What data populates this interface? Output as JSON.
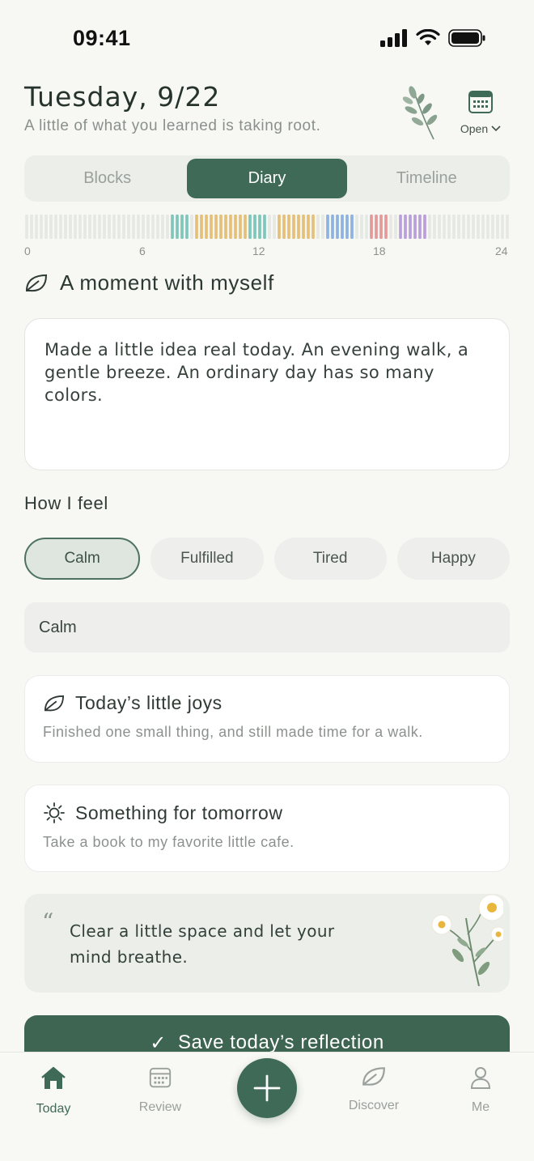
{
  "status": {
    "time": "09:41"
  },
  "header": {
    "date": "Tuesday, 9/22",
    "subtitle": "A little of what you learned is taking root.",
    "open_label": "Open"
  },
  "segments": [
    "Blocks",
    "Diary",
    "Timeline"
  ],
  "active_segment": "Diary",
  "timeline": {
    "labels": [
      "0",
      "6",
      "12",
      "18",
      "24"
    ],
    "colors": {
      "empty": "#e6e8e4",
      "teal": "#7fc6bb",
      "yellow": "#e6c07a",
      "blue": "#8eb3e0",
      "red": "#e49a9a",
      "purple": "#b9a0dc"
    }
  },
  "diary": {
    "section_title": "A moment with myself",
    "text": "Made a little idea real today. An evening walk, a gentle breeze. An ordinary day has so many colors."
  },
  "feel": {
    "label": "How I feel",
    "moods": [
      "Calm",
      "Fulfilled",
      "Tired",
      "Happy"
    ],
    "selected": "Calm",
    "input_value": "Calm"
  },
  "joys": {
    "title": "Today’s little joys",
    "text": "Finished one small thing, and still made time for a walk.",
    "icon": "leaf-icon"
  },
  "tomorrow": {
    "title": "Something for tomorrow",
    "text": "Take a book to my favorite little cafe.",
    "icon": "sun-icon"
  },
  "quote": {
    "mark": "“",
    "text": "Clear a little space and let your mind breathe."
  },
  "save": {
    "check": "✓",
    "label": "Save today’s reflection"
  },
  "tabs": {
    "today": "Today",
    "review": "Review",
    "discover": "Discover",
    "me": "Me"
  },
  "accent": "#3f6a57"
}
